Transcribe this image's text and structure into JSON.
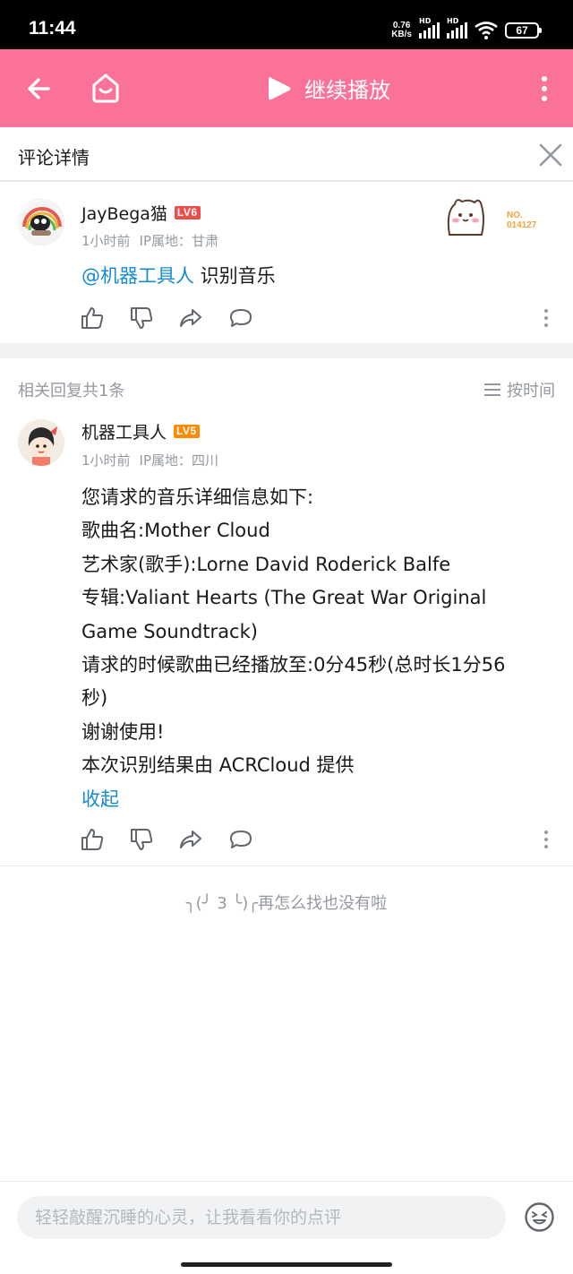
{
  "status_bar": {
    "time": "11:44",
    "net_speed_value": "0.76",
    "net_speed_unit": "KB/s",
    "hd_1": "HD",
    "hd_2": "HD",
    "battery": "67"
  },
  "header": {
    "play_label": "继续播放",
    "accent_color": "#fb7299"
  },
  "panel": {
    "title": "评论详情"
  },
  "main_comment": {
    "username": "JayBega猫",
    "level": "LV6",
    "time": "1小时前",
    "ip": "IP属地：甘肃",
    "mention": "@机器工具人",
    "text": " 识别音乐",
    "badge_no_label": "NO.",
    "badge_no_value": "014127"
  },
  "replies_header": {
    "count_label": "相关回复共1条",
    "sort_label": "按时间"
  },
  "reply": {
    "username": "机器工具人",
    "level": "LV5",
    "time": "1小时前",
    "ip": "IP属地：四川",
    "lines": [
      "您请求的音乐详细信息如下:",
      "歌曲名:Mother Cloud",
      "艺术家(歌手):Lorne David Roderick Balfe",
      "专辑:Valiant Hearts (The Great War Original",
      "Game Soundtrack)",
      "请求的时候歌曲已经播放至:0分45秒(总时长1分56",
      "秒)",
      "谢谢使用!",
      "本次识别结果由 ACRCloud 提供"
    ],
    "collapse_label": "收起"
  },
  "end_note": "╮(╯ 3 ╰)╭再怎么找也没有啦",
  "bottom_bar": {
    "placeholder": "轻轻敲醒沉睡的心灵，让我看看你的点评"
  }
}
